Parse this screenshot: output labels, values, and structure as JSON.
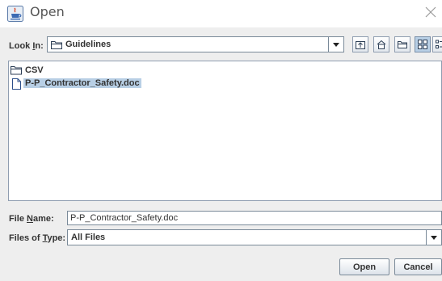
{
  "window": {
    "title": "Open",
    "icons": {
      "app": "java-cup-icon",
      "close": "close-icon"
    }
  },
  "look_in": {
    "label_prefix": "Look ",
    "label_mnemonic": "I",
    "label_suffix": "n:",
    "value": "Guidelines",
    "toolbar_icons": [
      "up-folder-icon",
      "home-folder-icon",
      "new-folder-icon",
      "list-view-icon",
      "details-view-icon"
    ],
    "active_view": "list-view-icon"
  },
  "file_list": {
    "items": [
      {
        "name": "CSV",
        "type": "folder",
        "selected": false
      },
      {
        "name": "P-P_Contractor_Safety.doc",
        "type": "file",
        "selected": true
      }
    ]
  },
  "file_name": {
    "label_prefix": "File ",
    "label_mnemonic": "N",
    "label_suffix": "ame:",
    "value": "P-P_Contractor_Safety.doc"
  },
  "file_type": {
    "label_prefix": "Files of ",
    "label_mnemonic": "T",
    "label_suffix": "ype:",
    "value": "All Files"
  },
  "buttons": {
    "open": "Open",
    "cancel": "Cancel"
  },
  "colors": {
    "selection": "#b8cfe5",
    "background": "#eeeeee",
    "border": "#7a8a99"
  }
}
